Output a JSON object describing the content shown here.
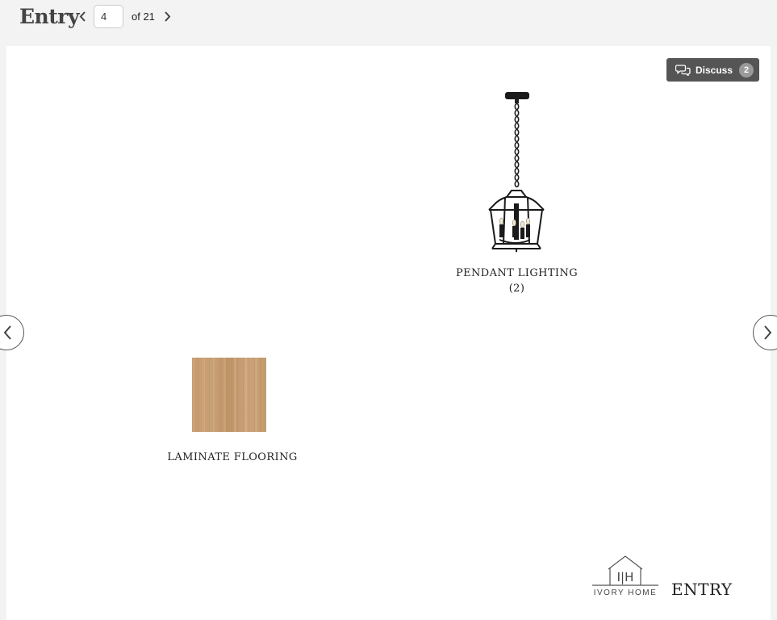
{
  "header": {
    "title": "Entry",
    "page_value": "4",
    "page_total": "of 21"
  },
  "discuss": {
    "label": "Discuss",
    "count": "2"
  },
  "items": [
    {
      "label": "PENDANT LIGHTING",
      "qty": "(2)"
    },
    {
      "label": "LAMINATE FLOORING"
    }
  ],
  "logo": {
    "monogram": "I|H",
    "name": "IVORY HOME"
  },
  "board_label": "ENTRY",
  "colors": {
    "discuss_bg": "#555555",
    "wood": "#c69a6e"
  }
}
